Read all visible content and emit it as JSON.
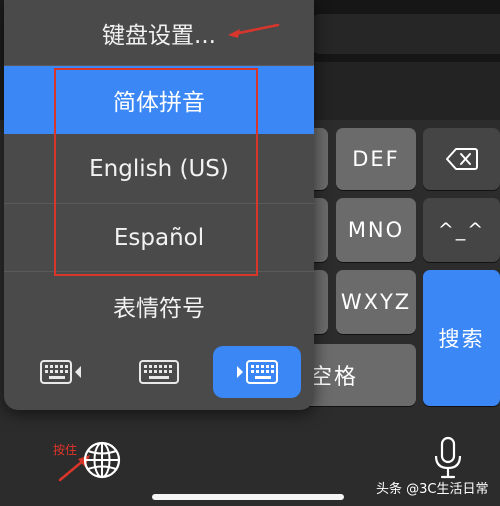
{
  "popup": {
    "settings_label": "键盘设置...",
    "languages": [
      {
        "label": "简体拼音",
        "selected": true
      },
      {
        "label": "English (US)",
        "selected": false
      },
      {
        "label": "Español",
        "selected": false
      }
    ],
    "emoji_label": "表情符号",
    "keyboard_modes": [
      {
        "icon": "keyboard-left-icon",
        "active": false
      },
      {
        "icon": "keyboard-full-icon",
        "active": false
      },
      {
        "icon": "keyboard-right-icon",
        "active": true
      }
    ]
  },
  "keyboard": {
    "keys": {
      "def": "DEF",
      "mno": "MNO",
      "wxyz": "WXYZ",
      "emoticon": "^_^",
      "space": "空格",
      "search": "搜索"
    },
    "delete_icon": "delete-icon",
    "globe_icon": "globe-icon",
    "mic_icon": "microphone-icon"
  },
  "annotations": {
    "hold_label": "按住"
  },
  "watermark": "头条 @3C生活日常",
  "colors": {
    "accent": "#3a87f5",
    "key": "#6b6b6b",
    "popup": "#4a4a4a",
    "annotation": "#d9362b"
  }
}
